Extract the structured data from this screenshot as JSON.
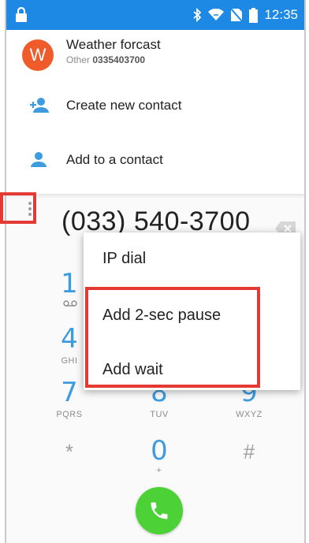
{
  "status_bar": {
    "time": "12:35",
    "icons": [
      "lock-icon",
      "bluetooth-icon",
      "wifi-icon",
      "no-sim-icon",
      "battery-icon"
    ]
  },
  "suggestions": {
    "contact": {
      "avatar_letter": "W",
      "avatar_color": "#ef5b2a",
      "name": "Weather forcast",
      "type_label": "Other",
      "number": "0335403700"
    },
    "create_new": {
      "label": "Create new contact",
      "icon": "add-person-icon"
    },
    "add_to": {
      "label": "Add to a contact",
      "icon": "person-icon"
    }
  },
  "dialer": {
    "number": "(033) 540-3700",
    "keys": [
      {
        "digit": "1",
        "letters": ""
      },
      {
        "digit": "4",
        "letters": "GHI"
      },
      {
        "digit": "7",
        "letters": "PQRS"
      },
      {
        "digit": "8",
        "letters": "TUV"
      },
      {
        "digit": "9",
        "letters": "WXYZ"
      },
      {
        "digit": "*",
        "letters": ""
      },
      {
        "digit": "0",
        "letters": "+"
      },
      {
        "digit": "#",
        "letters": ""
      }
    ],
    "accent_color": "#3d9be0",
    "call_color": "#4cd137"
  },
  "menu": {
    "items": [
      "IP dial",
      "Add 2-sec pause",
      "Add wait"
    ]
  },
  "annotation_color": "#e53935"
}
